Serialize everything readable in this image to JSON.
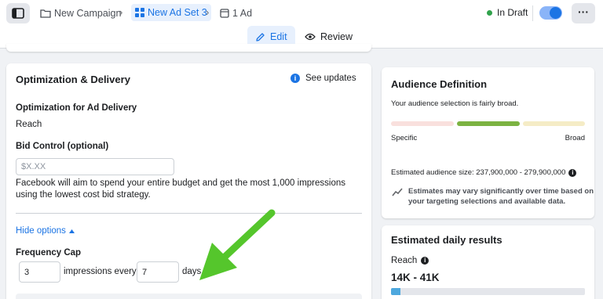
{
  "topbar": {
    "breadcrumbs": [
      {
        "label": "New Campaign",
        "icon": "folder-icon"
      },
      {
        "label": "New Ad Set 3",
        "icon": "grid-icon"
      },
      {
        "label": "1 Ad",
        "icon": "ad-icon"
      }
    ],
    "status": "In Draft",
    "status_color": "#31a24c",
    "toggle_on": true,
    "more_label": "···"
  },
  "tabs": [
    {
      "label": "Edit",
      "icon": "pencil-icon",
      "active": true
    },
    {
      "label": "Review",
      "icon": "eye-icon",
      "active": false
    }
  ],
  "optimization": {
    "title": "Optimization & Delivery",
    "see_updates": "See updates",
    "ad_delivery_label": "Optimization for Ad Delivery",
    "ad_delivery_value": "Reach",
    "bid_control_label": "Bid Control (optional)",
    "bid_placeholder": "$X.XX",
    "bid_help_line1": "Facebook will aim to spend your entire budget and get the most 1,000 impressions",
    "bid_help_line2": "using the lowest cost bid strategy.",
    "hide_options": "Hide options",
    "frequency_cap_label": "Frequency Cap",
    "impressions_value": "3",
    "impressions_text": "impressions every",
    "days_value": "7",
    "days_text": "days"
  },
  "audience": {
    "title": "Audience Definition",
    "description": "Your audience selection is fairly broad.",
    "specific_label": "Specific",
    "broad_label": "Broad",
    "size_text": "Estimated audience size: 237,900,000 - 279,900,000",
    "note_line1": "Estimates may vary significantly over time based on",
    "note_line2": "your targeting selections and available data.",
    "colors": {
      "low": "#f9e0dd",
      "mid": "#7cb342",
      "high": "#f5ecc6"
    }
  },
  "estimate": {
    "title": "Estimated daily results",
    "reach_label": "Reach",
    "reach_value": "14K - 41K",
    "reach_fraction": 0.05
  },
  "colors": {
    "accent": "#1b74e4",
    "arrow": "#55c62c"
  }
}
